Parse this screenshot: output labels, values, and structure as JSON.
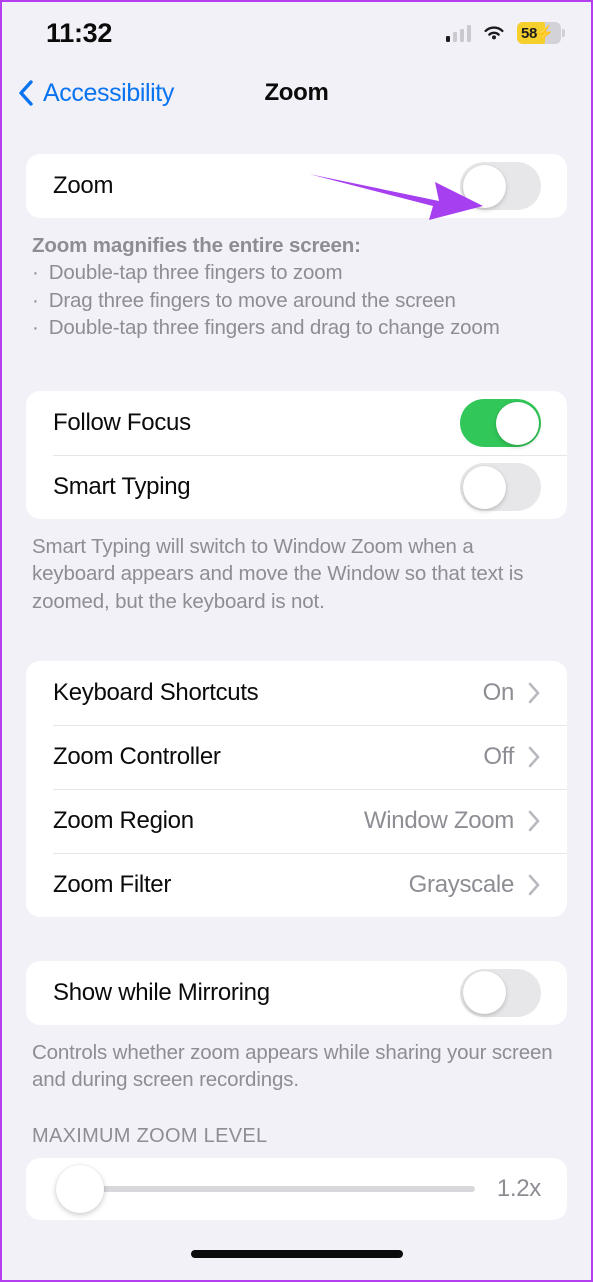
{
  "status_bar": {
    "time": "11:32",
    "signal_icon": "cellular-signal-icon",
    "signal_bars_filled": 1,
    "signal_bars_total": 4,
    "wifi_icon": "wifi-icon",
    "battery_percent": "58",
    "battery_charging_glyph": "⚡",
    "battery_color": "#f5cf2b"
  },
  "nav": {
    "back_label": "Accessibility",
    "back_icon": "chevron-left-icon",
    "title": "Zoom",
    "accent_color": "#0a74f0"
  },
  "zoom_section": {
    "row_label": "Zoom",
    "toggle_state": "off",
    "footer_title": "Zoom magnifies the entire screen:",
    "footer_bullets": [
      "Double-tap three fingers to zoom",
      "Drag three fingers to move around the screen",
      "Double-tap three fingers and drag to change zoom"
    ],
    "bullet_glyph": "·"
  },
  "focus_section": {
    "rows": [
      {
        "label": "Follow Focus",
        "toggle_state": "on"
      },
      {
        "label": "Smart Typing",
        "toggle_state": "off"
      }
    ],
    "footer": "Smart Typing will switch to Window Zoom when a keyboard appears and move the Window so that text is zoomed, but the keyboard is not."
  },
  "options_section": {
    "rows": [
      {
        "label": "Keyboard Shortcuts",
        "value": "On"
      },
      {
        "label": "Zoom Controller",
        "value": "Off"
      },
      {
        "label": "Zoom Region",
        "value": "Window Zoom"
      },
      {
        "label": "Zoom Filter",
        "value": "Grayscale"
      }
    ],
    "chevron_icon": "chevron-right-icon"
  },
  "mirroring_section": {
    "row_label": "Show while Mirroring",
    "toggle_state": "off",
    "footer": "Controls whether zoom appears while sharing your screen and during screen recordings."
  },
  "max_zoom_section": {
    "group_header": "MAXIMUM ZOOM LEVEL",
    "slider_value_label": "1.2x",
    "slider_position_percent": 0
  },
  "annotation": {
    "arrow_icon": "pointer-arrow-annotation",
    "color": "#a63ff0"
  },
  "colors": {
    "page_background": "#f2f1f7",
    "card_background": "#ffffff",
    "switch_on": "#32c759",
    "switch_off": "#e7e7ea",
    "secondary_text": "#8d8d94",
    "frame_border": "#b43ff0"
  }
}
